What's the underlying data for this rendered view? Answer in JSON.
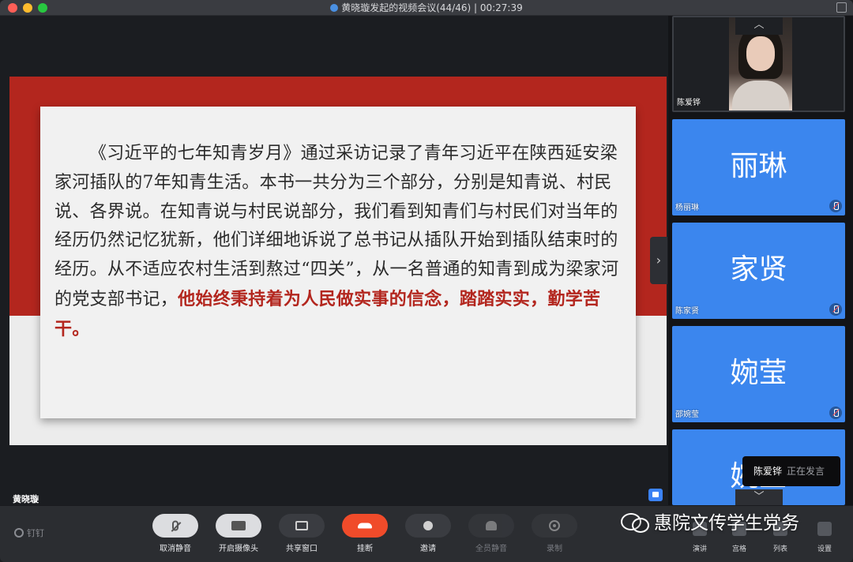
{
  "window": {
    "title": "黄晓璇发起的视频会议(44/46) | 00:27:39"
  },
  "slide": {
    "body": "《习近平的七年知青岁月》通过采访记录了青年习近平在陕西延安梁家河插队的7年知青生活。本书一共分为三个部分，分别是知青说、村民说、各界说。在知青说与村民说部分，我们看到知青们与村民们对当年的经历仍然记忆犹新，他们详细地诉说了总书记从插队开始到插队结束时的经历。从不适应农村生活到熬过“四关”，从一名普通的知青到成为梁家河的党支部书记，",
    "highlight": "他始终秉持着为人民做实事的信念，踏踏实实，勤学苦干。"
  },
  "presenter": {
    "name": "黄晓璇"
  },
  "participants": [
    {
      "name": "陈爱铧",
      "type": "video"
    },
    {
      "name": "杨丽琳",
      "avatar": "丽琳",
      "muted": true
    },
    {
      "name": "陈家贤",
      "avatar": "家贤",
      "muted": true
    },
    {
      "name": "邵婉莹",
      "avatar": "婉莹",
      "muted": true
    },
    {
      "avatar": "婉莹"
    }
  ],
  "speaking_toast": {
    "name": "陈爱铧",
    "status": "正在发言"
  },
  "toolbar": {
    "brand": "钉钉",
    "buttons": [
      {
        "label": "取消静音",
        "icon": "mic-off-icon"
      },
      {
        "label": "开启摄像头",
        "icon": "camera-icon"
      },
      {
        "label": "共享窗口",
        "icon": "share-screen-icon"
      },
      {
        "label": "挂断",
        "icon": "hang-up-icon"
      },
      {
        "label": "邀请",
        "icon": "invite-icon"
      },
      {
        "label": "全员静音",
        "icon": "mute-all-icon"
      },
      {
        "label": "录制",
        "icon": "record-icon"
      }
    ],
    "right": [
      {
        "label": "演讲",
        "icon": "speaker-view-icon"
      },
      {
        "label": "宫格",
        "icon": "grid-view-icon"
      },
      {
        "label": "列表",
        "icon": "list-view-icon"
      },
      {
        "label": "设置",
        "icon": "settings-icon"
      }
    ]
  },
  "watermark": {
    "text": "惠院文传学生党务"
  },
  "colors": {
    "accent_blue": "#3b86ee",
    "slide_red": "#b3261e",
    "hangup_red": "#f04b2a"
  }
}
